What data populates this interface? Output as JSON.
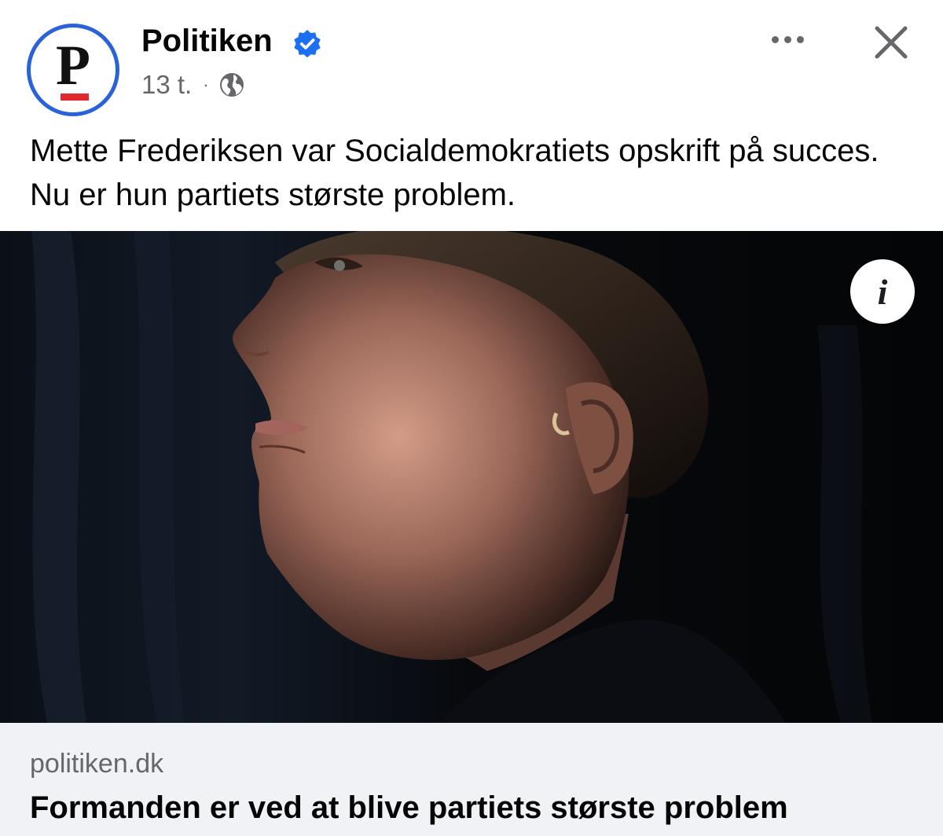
{
  "post": {
    "page_name": "Politiken",
    "avatar_letter": "P",
    "verified_icon": "verified-badge-icon",
    "timestamp": "13 t.",
    "separator": "·",
    "audience_icon": "globe-icon",
    "caption": "Mette Frederiksen var Socialdemokratiets opskrift på succes. Nu er hun partiets største problem.",
    "more_icon": "more-options-icon",
    "close_icon": "close-icon"
  },
  "media": {
    "info_label": "i",
    "info_icon": "info-icon"
  },
  "link_preview": {
    "domain": "politiken.dk",
    "title": "Formanden er ved at blive partiets største problem"
  },
  "colors": {
    "verified_blue": "#1d6ff2",
    "avatar_ring": "#2a62d9",
    "logo_red": "#e0282e",
    "secondary_text": "#65676b",
    "footer_bg": "#f0f2f5"
  }
}
